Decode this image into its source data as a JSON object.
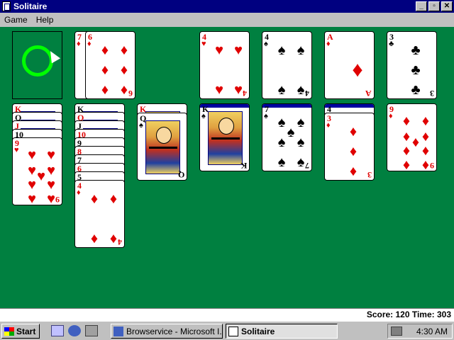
{
  "window": {
    "title": "Solitaire",
    "controls": {
      "minimize": "_",
      "maximize": "▫",
      "close": "✕"
    }
  },
  "menu": {
    "items": [
      "Game",
      "Help"
    ]
  },
  "status": {
    "score_text": "Score: 120 Time: 303"
  },
  "taskbar": {
    "start_label": "Start",
    "tasks": [
      {
        "label": "Browservice - Microsoft I...",
        "active": false
      },
      {
        "label": "Solitaire",
        "active": true
      }
    ],
    "clock": "4:30 AM"
  },
  "board": {
    "deck": {
      "state": "empty-recycle"
    },
    "waste": [
      {
        "rank": "7",
        "suit": "♦",
        "color": "red"
      },
      {
        "rank": "6",
        "suit": "♦",
        "color": "red"
      }
    ],
    "foundations": [
      {
        "rank": "4",
        "suit": "♥",
        "color": "red"
      },
      {
        "rank": "4",
        "suit": "♠",
        "color": "black"
      },
      {
        "rank": "A",
        "suit": "♦",
        "color": "red"
      },
      {
        "rank": "3",
        "suit": "♣",
        "color": "black"
      }
    ],
    "tableau": [
      [
        {
          "rank": "K",
          "suit": "♥",
          "color": "red"
        },
        {
          "rank": "Q",
          "suit": "♠",
          "color": "black"
        },
        {
          "rank": "J",
          "suit": "♥",
          "color": "red"
        },
        {
          "rank": "10",
          "suit": "♠",
          "color": "black"
        },
        {
          "rank": "9",
          "suit": "♥",
          "color": "red"
        }
      ],
      [
        {
          "rank": "K",
          "suit": "♠",
          "color": "black"
        },
        {
          "rank": "Q",
          "suit": "♥",
          "color": "red"
        },
        {
          "rank": "J",
          "suit": "♠",
          "color": "black"
        },
        {
          "rank": "10",
          "suit": "♥",
          "color": "red"
        },
        {
          "rank": "9",
          "suit": "♠",
          "color": "black"
        },
        {
          "rank": "8",
          "suit": "♥",
          "color": "red"
        },
        {
          "rank": "7",
          "suit": "♠",
          "color": "black"
        },
        {
          "rank": "6",
          "suit": "♥",
          "color": "red"
        },
        {
          "rank": "5",
          "suit": "♠",
          "color": "black"
        },
        {
          "rank": "4",
          "suit": "♦",
          "color": "red"
        }
      ],
      [
        {
          "rank": "K",
          "suit": "♥",
          "color": "red"
        },
        {
          "rank": "Q",
          "suit": "♠",
          "color": "black"
        }
      ],
      [
        {
          "rank": "K",
          "suit": "♠",
          "color": "black"
        }
      ],
      [
        {
          "rank": "7",
          "suit": "♠",
          "color": "black"
        }
      ],
      [
        {
          "rank": "4",
          "suit": "♠",
          "color": "black"
        },
        {
          "rank": "3",
          "suit": "♦",
          "color": "red"
        }
      ],
      [
        {
          "rank": "9",
          "suit": "♦",
          "color": "red"
        }
      ]
    ]
  }
}
